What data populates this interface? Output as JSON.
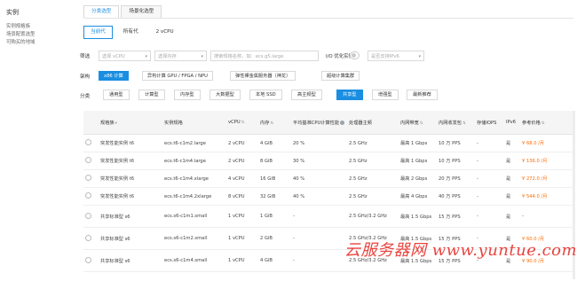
{
  "sidebar": {
    "title": "实例",
    "items": [
      "实例规格族",
      "场景配置选型",
      "可购买的地域"
    ]
  },
  "tabs_top": [
    "分类选型",
    "场景化选型"
  ],
  "tabs_generation": [
    "当前代",
    "所有代",
    "2 vCPU"
  ],
  "filter_row": {
    "label": "筛选",
    "vcpu_placeholder": "选择 vCPU",
    "mem_placeholder": "选择内存",
    "search_placeholder": "搜索规格名称，如：ecs.g5.large",
    "io_label": "I/O 优化实例",
    "ipv6_placeholder": "是否支持IPv6"
  },
  "arch_row": {
    "label": "架构",
    "buttons": [
      "x86 计算",
      "异构计算 GPU / FPGA / NPU",
      "弹性裸金属服务器（神龙）",
      "超级计算集群"
    ]
  },
  "cat_row": {
    "label": "分类",
    "buttons": [
      "通用型",
      "计算型",
      "内存型",
      "大数据型",
      "本地 SSD",
      "高主频型",
      "共享型",
      "增强型",
      "最新推荐"
    ]
  },
  "table": {
    "headers": [
      "规格族",
      "实例规格",
      "vCPU",
      "内存",
      "平均基准CPU计算性能",
      "处理器主频",
      "内网带宽",
      "内网收发包",
      "存储IOPS",
      "IPv6",
      "参考价格"
    ],
    "rows": [
      [
        "突发性能实例 t6",
        "ecs.t6-c1m2.large",
        "2 vCPU",
        "4 GiB",
        "20 %",
        "2.5 GHz",
        "最高 1 Gbps",
        "10 万 PPS",
        "-",
        "是",
        "¥ 68.0 /月"
      ],
      [
        "突发性能实例 t6",
        "ecs.t6-c1m4.large",
        "2 vCPU",
        "8 GiB",
        "30 %",
        "2.5 GHz",
        "最高 1 Gbps",
        "10 万 PPS",
        "-",
        "是",
        "¥ 136.0 /月"
      ],
      [
        "突发性能实例 t6",
        "ecs.t6-c1m4.xlarge",
        "4 vCPU",
        "16 GiB",
        "40 %",
        "2.5 GHz",
        "最高 2 Gbps",
        "20 万 PPS",
        "-",
        "是",
        "¥ 272.0 /月"
      ],
      [
        "突发性能实例 t6",
        "ecs.t6-c1m4.2xlarge",
        "8 vCPU",
        "32 GiB",
        "40 %",
        "2.5 GHz",
        "最高 4 Gbps",
        "40 万 PPS",
        "-",
        "是",
        "¥ 544.0 /月"
      ],
      [
        "共享标准型 s6",
        "ecs.s6-c1m1.small",
        "1 vCPU",
        "1 GiB",
        "-",
        "2.5 GHz/3.2 GHz",
        "最高 1.5 Gbps",
        "15 万 PPS",
        "-",
        "是",
        "-"
      ],
      [
        "共享标准型 s6",
        "ecs.s6-c1m2.small",
        "1 vCPU",
        "2 GiB",
        "-",
        "2.5 GHz/3.2 GHz",
        "最高 1.5 Gbps",
        "15 万 PPS",
        "-",
        "是",
        "¥ 60.0 /月"
      ],
      [
        "共享标准型 s6",
        "ecs.s6-c1m4.small",
        "1 vCPU",
        "4 GiB",
        "-",
        "2.5 GHz/3.2 GHz",
        "最高 1.5 Gbps",
        "15 万 PPS",
        "-",
        "是",
        "¥ 90.0 /月"
      ]
    ]
  },
  "watermark": "云服务器网 www.yuntue.com",
  "colors": {
    "accent": "#1a8ee1",
    "price": "#ff6a00",
    "watermark": "#e8443f"
  }
}
